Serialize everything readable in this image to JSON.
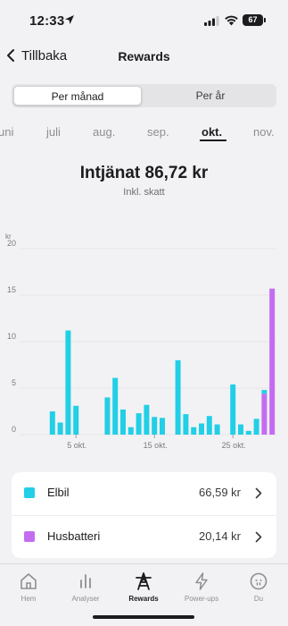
{
  "status": {
    "time": "12:33",
    "battery": "67"
  },
  "header": {
    "back_label": "Tillbaka",
    "title": "Rewards"
  },
  "segments": {
    "left": "Per månad",
    "right": "Per år",
    "selected": "left"
  },
  "months": [
    "uni",
    "juli",
    "aug.",
    "sep.",
    "okt.",
    "nov."
  ],
  "active_month": "okt.",
  "earnings": {
    "title": "Intjänat 86,72 kr",
    "subtitle": "Inkl. skatt"
  },
  "colors": {
    "elbil": "#22cfe6",
    "husbatteri": "#c46cf0",
    "grid": "#e6e6ea",
    "axis_text": "#7a7a80"
  },
  "chart_data": {
    "type": "bar",
    "ylabel": "kr",
    "ylim": [
      0,
      20
    ],
    "yticks": [
      0,
      5,
      10,
      15,
      20
    ],
    "x": [
      1,
      2,
      3,
      4,
      5,
      6,
      7,
      8,
      9,
      10,
      11,
      12,
      13,
      14,
      15,
      16,
      17,
      18,
      19,
      20,
      21,
      22,
      23,
      24,
      25,
      26,
      27,
      28,
      29,
      30,
      31
    ],
    "xticks": [
      {
        "day": 5,
        "label": "5 okt."
      },
      {
        "day": 15,
        "label": "15 okt."
      },
      {
        "day": 25,
        "label": "25 okt."
      }
    ],
    "series": [
      {
        "name": "Elbil",
        "color": "#22cfe6",
        "values": [
          0,
          2.5,
          1.3,
          11.2,
          3.1,
          0,
          0,
          0,
          4.0,
          6.1,
          2.7,
          0.8,
          2.3,
          3.2,
          1.9,
          1.8,
          0,
          8.0,
          2.2,
          0.8,
          1.2,
          2.0,
          1.1,
          0,
          5.4,
          1.1,
          0.4,
          1.7,
          0,
          0,
          0
        ]
      },
      {
        "name": "Husbatteri",
        "color": "#c46cf0",
        "values": [
          0,
          0,
          0,
          0,
          0,
          0,
          0,
          0,
          0,
          0,
          0,
          0,
          0,
          0,
          0,
          0,
          0,
          0,
          0,
          0,
          0,
          0,
          0,
          0,
          0,
          0,
          0,
          0,
          4.4,
          15.7,
          0
        ]
      }
    ],
    "stacked_overlay": {
      "day": 29,
      "top_value": 4.8
    }
  },
  "legend": [
    {
      "label": "Elbil",
      "value": "66,59 kr",
      "color": "#22cfe6"
    },
    {
      "label": "Husbatteri",
      "value": "20,14 kr",
      "color": "#c46cf0"
    }
  ],
  "tabs": [
    {
      "label": "Hem",
      "icon": "home-icon"
    },
    {
      "label": "Analyser",
      "icon": "analytics-icon"
    },
    {
      "label": "Rewards",
      "icon": "rewards-tower-icon"
    },
    {
      "label": "Power-ups",
      "icon": "bolt-icon"
    },
    {
      "label": "Du",
      "icon": "profile-icon"
    }
  ],
  "active_tab": "Rewards"
}
